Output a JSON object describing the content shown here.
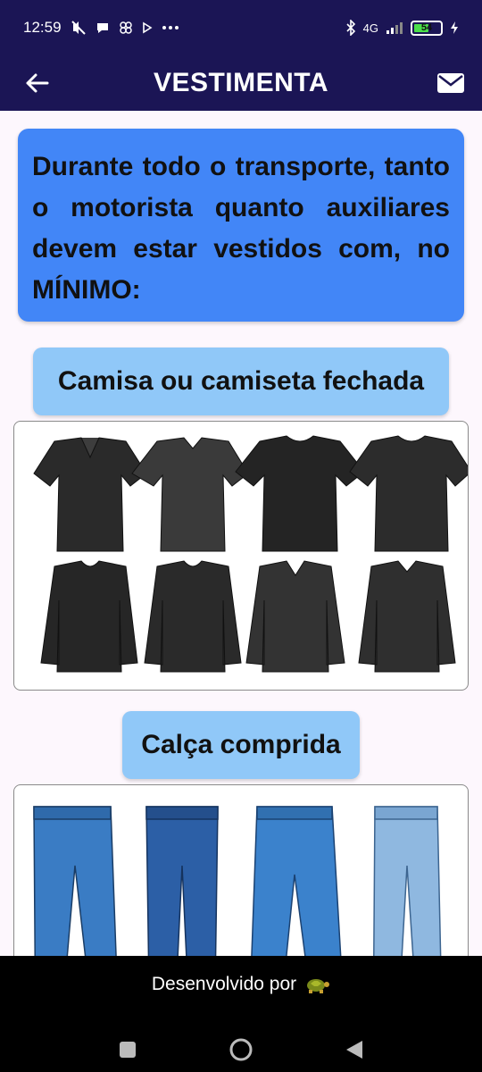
{
  "status_bar": {
    "time": "12:59",
    "network": "4G",
    "battery": "54",
    "battery_level": 0.54,
    "icons": [
      "mute-icon",
      "chat-icon",
      "pinwheel-icon",
      "play-icon",
      "more-dots-icon",
      "bluetooth-icon",
      "signal-icon",
      "battery-icon",
      "charging-icon"
    ]
  },
  "app_bar": {
    "title": "VESTIMENTA",
    "back_icon": "arrow-left-icon",
    "mail_icon": "mail-icon"
  },
  "notice": {
    "text": "Durante todo o transporte, tanto o motorista quanto auxiliares devem estar vestidos com, no MÍNIMO:",
    "color": "#4286f7"
  },
  "items": [
    {
      "label": "Camisa ou camiseta fechada"
    },
    {
      "label": "Calça comprida"
    }
  ],
  "footer": {
    "text": "Desenvolvido por",
    "icon": "turtle-icon"
  },
  "nav": {
    "recents_icon": "square-icon",
    "home_icon": "circle-icon",
    "back_icon": "triangle-back-icon"
  },
  "colors": {
    "header": "#1b1555",
    "chip": "#90c8f8",
    "background": "#fdf7fd"
  }
}
